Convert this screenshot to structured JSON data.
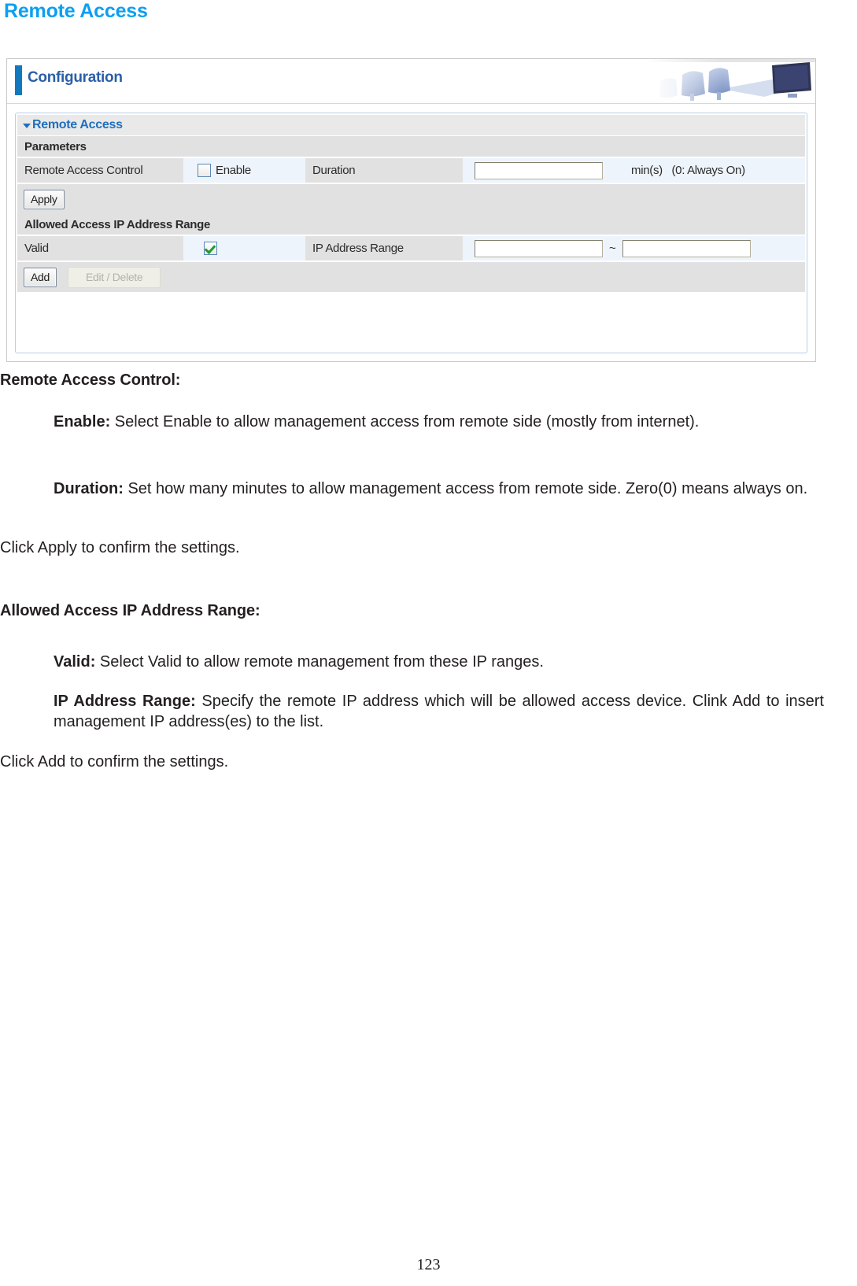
{
  "page": {
    "title": "Remote Access",
    "number": "123"
  },
  "screenshot": {
    "config_banner": {
      "label": "Configuration",
      "art_alt": "office-desk-illustration"
    },
    "section": {
      "title": "Remote Access"
    },
    "parameters_group": {
      "heading": "Parameters",
      "row": {
        "label": "Remote Access Control",
        "enable_label": "Enable",
        "enable_checked": false,
        "duration_label": "Duration",
        "duration_value": "",
        "duration_placeholder": "",
        "unit_note": "min(s)   (0: Always On)"
      },
      "apply_button": "Apply"
    },
    "ip_range_group": {
      "heading": "Allowed Access IP Address Range",
      "row": {
        "label": "Valid",
        "valid_checked": true,
        "range_label": "IP Address Range",
        "range_start": "",
        "range_end": "",
        "separator": "~"
      },
      "add_button": "Add",
      "edit_delete_button": "Edit / Delete"
    },
    "colors": {
      "accent_blue": "#1478be",
      "section_blue": "#1f6fbe",
      "row_bg": "#eef4fb",
      "label_bg": "#e1e1e1",
      "check_green": "#1a9c2a"
    }
  },
  "doc": {
    "heading1": "Remote Access Control:",
    "item_enable_term": "Enable:",
    "item_enable_text": " Select Enable to allow management access from remote side (mostly from internet).",
    "item_duration_term": "Duration:",
    "item_duration_text": " Set how many minutes to allow management access from remote side. Zero(0) means always on.",
    "click_apply": "Click Apply to confirm the settings.",
    "heading2": "Allowed Access IP Address Range:",
    "item_valid_term": "Valid:",
    "item_valid_text": " Select Valid to allow remote management from these IP ranges.",
    "item_range_term": "IP Address Range:",
    "item_range_text": " Specify the remote IP address which will be allowed access device. Clink Add to insert management IP address(es) to the list.",
    "click_add": "Click Add to confirm the settings."
  }
}
